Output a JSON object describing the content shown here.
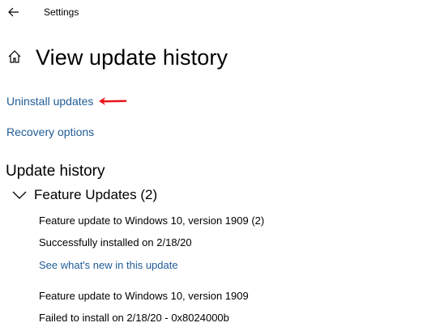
{
  "window": {
    "title": "Settings",
    "back_icon": "back-arrow-icon"
  },
  "header": {
    "home_icon": "home-icon",
    "title": "View update history"
  },
  "links": {
    "uninstall_updates": "Uninstall updates",
    "recovery_options": "Recovery options"
  },
  "annotation": {
    "arrow_color": "#e8141c",
    "arrow_icon": "red-arrow-annotation"
  },
  "update_history": {
    "title": "Update history",
    "groups": [
      {
        "label": "Feature Updates (2)",
        "expanded": true,
        "entries": [
          {
            "name": "Feature update to Windows 10, version 1909 (2)",
            "status": "Successfully installed on 2/18/20",
            "link": "See what's new in this update"
          },
          {
            "name": "Feature update to Windows 10, version 1909",
            "status": "Failed to install on 2/18/20 - 0x8024000b"
          }
        ]
      }
    ]
  },
  "colors": {
    "link": "#1f5c96",
    "text": "#000000",
    "background": "#ffffff"
  }
}
